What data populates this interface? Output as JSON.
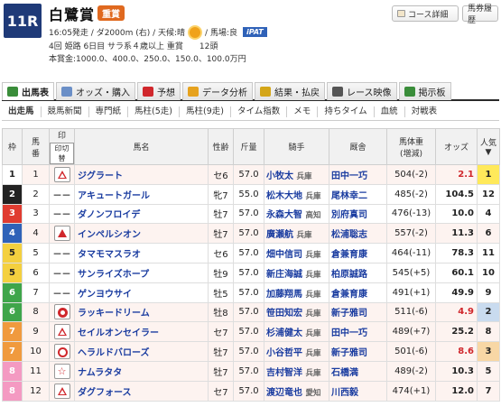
{
  "race": {
    "number": "11R",
    "name": "白鷺賞",
    "grade": "重賞",
    "info_prefix": "16:05発走 / ダ2000m (右) / 天候:晴",
    "info_suffix": "/ 馬場:良",
    "ipat": "iPAT",
    "detail": "4回 姫路 6日目 サラ系４歳以上 重賞　　12頭",
    "prize": "本賞金:1000.0、400.0、250.0、150.0、100.0万円"
  },
  "buttons": {
    "course": "コース詳細",
    "history": "馬券履歴"
  },
  "tabs": [
    {
      "label": "出馬表",
      "icon": "table-icon",
      "color": "#3a8d3a"
    },
    {
      "label": "オッズ・購入",
      "icon": "odds-icon",
      "color": "#6b8fc7"
    },
    {
      "label": "予想",
      "icon": "target-icon",
      "color": "#d0272c"
    },
    {
      "label": "データ分析",
      "icon": "chart-icon",
      "color": "#e6a21e"
    },
    {
      "label": "結果・払戻",
      "icon": "coins-icon",
      "color": "#d4a619"
    },
    {
      "label": "レース映像",
      "icon": "video-icon",
      "color": "#555555"
    },
    {
      "label": "掲示板",
      "icon": "chat-icon",
      "color": "#3a8d3a"
    }
  ],
  "subtabs": [
    "出走馬",
    "競馬新聞",
    "専門紙",
    "馬柱(5走)",
    "馬柱(9走)",
    "タイム指数",
    "メモ",
    "持ちタイム",
    "血統",
    "対戦表"
  ],
  "columns": {
    "waku": "枠",
    "umaban_1": "馬",
    "umaban_2": "番",
    "mark": "印",
    "mark_sub": "印切替",
    "horse": "馬名",
    "sex_age": "性齢",
    "weight": "斤量",
    "jockey": "騎手",
    "trainer": "厩舎",
    "body_1": "馬体重",
    "body_2": "(増減)",
    "odds": "オッズ",
    "ninki_1": "人気",
    "ninki_2": "▼"
  },
  "waku_colors": {
    "1": "#ffffff",
    "2": "#222222",
    "3": "#e03c31",
    "4": "#2f62b8",
    "5": "#f4d03f",
    "6": "#3fa54a",
    "7": "#f09a3e",
    "8": "#f49ac2"
  },
  "rows": [
    {
      "waku": "1",
      "num": "1",
      "mark": "tri-hollow",
      "horse": "ジグラート",
      "sex_age": "セ6",
      "weight": "57.0",
      "jockey": "小牧太",
      "jaff": "兵庫",
      "trainer": "田中一巧",
      "body": "504(-2)",
      "odds": "2.1",
      "odds_pop": true,
      "ninki": "1",
      "hl": true
    },
    {
      "waku": "2",
      "num": "2",
      "mark": "dash",
      "horse": "アキュートガール",
      "sex_age": "牝7",
      "weight": "55.0",
      "jockey": "松木大地",
      "jaff": "兵庫",
      "trainer": "尾林幸二",
      "body": "485(-2)",
      "odds": "104.5",
      "odds_pop": false,
      "ninki": "12",
      "hl": false
    },
    {
      "waku": "3",
      "num": "3",
      "mark": "dash",
      "horse": "ダノンフロイデ",
      "sex_age": "牡7",
      "weight": "57.0",
      "jockey": "永森大智",
      "jaff": "高知",
      "trainer": "別府真司",
      "body": "476(-13)",
      "odds": "10.0",
      "odds_pop": false,
      "ninki": "4",
      "hl": false
    },
    {
      "waku": "4",
      "num": "4",
      "mark": "tri-solid",
      "horse": "インペルシオン",
      "sex_age": "牡7",
      "weight": "57.0",
      "jockey": "廣瀬航",
      "jaff": "兵庫",
      "trainer": "松浦聡志",
      "body": "557(-2)",
      "odds": "11.3",
      "odds_pop": false,
      "ninki": "6",
      "hl": true
    },
    {
      "waku": "5",
      "num": "5",
      "mark": "dash",
      "horse": "タマモマスラオ",
      "sex_age": "セ6",
      "weight": "57.0",
      "jockey": "畑中信司",
      "jaff": "兵庫",
      "trainer": "倉兼育康",
      "body": "464(-11)",
      "odds": "78.3",
      "odds_pop": false,
      "ninki": "11",
      "hl": false
    },
    {
      "waku": "5",
      "num": "6",
      "mark": "dash",
      "horse": "サンライズホープ",
      "sex_age": "牡9",
      "weight": "57.0",
      "jockey": "新庄海誠",
      "jaff": "兵庫",
      "trainer": "柏原誠路",
      "body": "545(+5)",
      "odds": "60.1",
      "odds_pop": false,
      "ninki": "10",
      "hl": false
    },
    {
      "waku": "6",
      "num": "7",
      "mark": "dash",
      "horse": "ゲンヨウサイ",
      "sex_age": "牡5",
      "weight": "57.0",
      "jockey": "加藤翔馬",
      "jaff": "兵庫",
      "trainer": "倉兼育康",
      "body": "491(+1)",
      "odds": "49.9",
      "odds_pop": false,
      "ninki": "9",
      "hl": false
    },
    {
      "waku": "6",
      "num": "8",
      "mark": "dbl-circle",
      "horse": "ラッキードリーム",
      "sex_age": "牡8",
      "weight": "57.0",
      "jockey": "笹田知宏",
      "jaff": "兵庫",
      "trainer": "新子雅司",
      "body": "511(-6)",
      "odds": "4.9",
      "odds_pop": true,
      "ninki": "2",
      "hl": true
    },
    {
      "waku": "7",
      "num": "9",
      "mark": "tri-hollow",
      "horse": "セイルオンセイラー",
      "sex_age": "セ7",
      "weight": "57.0",
      "jockey": "杉浦健太",
      "jaff": "兵庫",
      "trainer": "田中一巧",
      "body": "489(+7)",
      "odds": "25.2",
      "odds_pop": false,
      "ninki": "8",
      "hl": true
    },
    {
      "waku": "7",
      "num": "10",
      "mark": "circle",
      "horse": "ヘラルドバローズ",
      "sex_age": "牡7",
      "weight": "57.0",
      "jockey": "小谷哲平",
      "jaff": "兵庫",
      "trainer": "新子雅司",
      "body": "501(-6)",
      "odds": "8.6",
      "odds_pop": true,
      "ninki": "3",
      "hl": true
    },
    {
      "waku": "8",
      "num": "11",
      "mark": "star",
      "horse": "ナムラタタ",
      "sex_age": "牡7",
      "weight": "57.0",
      "jockey": "吉村智洋",
      "jaff": "兵庫",
      "trainer": "石橋満",
      "body": "489(-2)",
      "odds": "10.3",
      "odds_pop": false,
      "ninki": "5",
      "hl": true
    },
    {
      "waku": "8",
      "num": "12",
      "mark": "tri-hollow",
      "horse": "ダグフォース",
      "sex_age": "セ7",
      "weight": "57.0",
      "jockey": "渡辺竜也",
      "jaff": "愛知",
      "trainer": "川西毅",
      "body": "474(+1)",
      "odds": "12.0",
      "odds_pop": false,
      "ninki": "7",
      "hl": true
    }
  ]
}
